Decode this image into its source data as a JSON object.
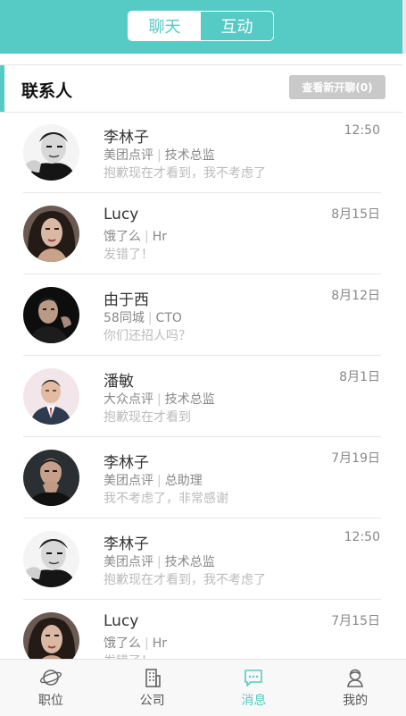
{
  "header": {
    "tabs": [
      {
        "label": "聊天",
        "active": true
      },
      {
        "label": "互动",
        "active": false
      }
    ]
  },
  "contacts_section": {
    "title": "联系人",
    "new_button": "查看新开聊(0)"
  },
  "conversations": [
    {
      "name": "李林子",
      "company": "美团点评",
      "role": "技术总监",
      "message": "抱歉现在才看到，我不考虑了",
      "time": "12:50"
    },
    {
      "name": "Lucy",
      "company": "饿了么",
      "role": "Hr",
      "message": "发错了！",
      "time": "8月15日"
    },
    {
      "name": "由于西",
      "company": "58同城",
      "role": "CTO",
      "message": "你们还招人吗？",
      "time": "8月12日"
    },
    {
      "name": "潘敏",
      "company": "大众点评",
      "role": "技术总监",
      "message": "抱歉现在才看到",
      "time": "8月1日"
    },
    {
      "name": "李林子",
      "company": "美团点评",
      "role": "总助理",
      "message": "我不考虑了，非常感谢",
      "time": "7月19日"
    },
    {
      "name": "李林子",
      "company": "美团点评",
      "role": "技术总监",
      "message": "抱歉现在才看到，我不考虑了",
      "time": "12:50"
    },
    {
      "name": "Lucy",
      "company": "饿了么",
      "role": "Hr",
      "message": "发错了！",
      "time": "7月15日"
    }
  ],
  "tabbar": {
    "items": [
      {
        "label": "职位",
        "icon": "planet-icon",
        "active": false
      },
      {
        "label": "公司",
        "icon": "building-icon",
        "active": false
      },
      {
        "label": "消息",
        "icon": "chat-icon",
        "active": true
      },
      {
        "label": "我的",
        "icon": "person-icon",
        "active": false
      }
    ]
  },
  "colors": {
    "accent": "#56cac4",
    "badge": "#c9c9c9"
  }
}
